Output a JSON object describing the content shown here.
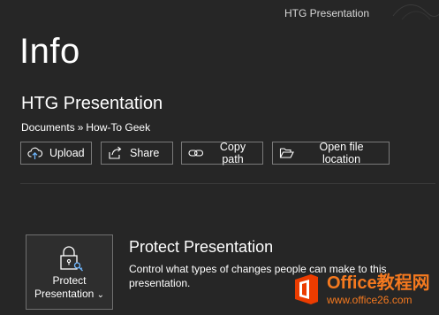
{
  "window": {
    "title": "HTG Presentation"
  },
  "page": {
    "heading": "Info"
  },
  "document": {
    "name": "HTG Presentation",
    "path": [
      "Documents",
      "How-To Geek"
    ],
    "path_separator": "»"
  },
  "actions": {
    "upload": "Upload",
    "share": "Share",
    "copy_path": "Copy path",
    "open_location": "Open file location"
  },
  "protect": {
    "tile_label_1": "Protect",
    "tile_label_2": "Presentation",
    "tile_caret": "⌄",
    "title": "Protect Presentation",
    "description": "Control what types of changes people can make to this presentation."
  },
  "watermark": {
    "brand": "Office教程网",
    "url": "www.office26.com"
  },
  "colors": {
    "background": "#262626",
    "border": "#7a7a7a",
    "watermark": "#f4791f",
    "icon_accent": "#6fb7ff"
  }
}
